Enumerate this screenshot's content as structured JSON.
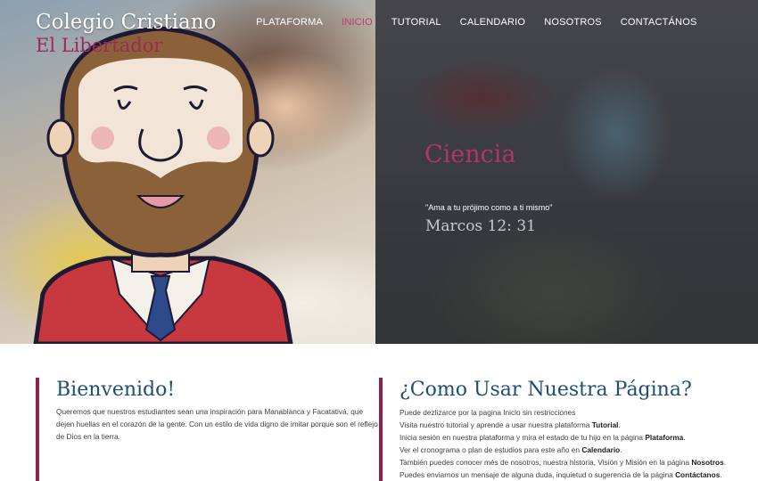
{
  "brand": {
    "title": "Colegio Cristiano",
    "subtitle": "El Libertador"
  },
  "nav": {
    "items": [
      {
        "label": "PLATAFORMA",
        "active": false
      },
      {
        "label": "INICIO",
        "active": true
      },
      {
        "label": "TUTORIAL",
        "active": false
      },
      {
        "label": "CALENDARIO",
        "active": false
      },
      {
        "label": "NOSOTROS",
        "active": false
      },
      {
        "label": "CONTACTÁNOS",
        "active": false
      }
    ]
  },
  "slide": {
    "title": "Ciencia",
    "quote": "\"Ama a tu prójimo como a ti mismo\"",
    "reference": "Marcos 12: 31"
  },
  "welcome": {
    "heading": "Bienvenido!",
    "text": "Queremos que nuestros estudiantes sean una inspiración para Manablanca y Facatativá, que dejen huellas en el corazón de la gente. Con un estilo de vida digno de imitar porque son el reflejo de Dios en la tierra."
  },
  "howto": {
    "heading": "¿Como Usar Nuestra Página?",
    "lines": [
      {
        "text": "Puede dezlizarce por la pagina Inicio sin restricciones",
        "bold": ""
      },
      {
        "text": "Visita nuestro tutorial y aprende a usar nuestra plataforma ",
        "bold": "Tutorial",
        "after": "."
      },
      {
        "text": "Inicia sesión en nuestra plataforma y mira el estado de tu hijo en la página ",
        "bold": "Plataforma",
        "after": "."
      },
      {
        "text": "Ver el cronograma o plan de estudios para este año en ",
        "bold": "Calendario",
        "after": "."
      },
      {
        "text": "También puedes conocer més de nosotros, nuestra historia, Visión y Misión en la página ",
        "bold": "Nosotros",
        "after": "."
      },
      {
        "text": "Puedes enviarnos un mensaje de alguna duda, inquietud o sugerencia de la página ",
        "bold": "Contáctanos",
        "after": "."
      }
    ]
  },
  "colors": {
    "accent": "#9e2857",
    "heading": "#1e4f72",
    "nav_active": "#c2386f"
  }
}
